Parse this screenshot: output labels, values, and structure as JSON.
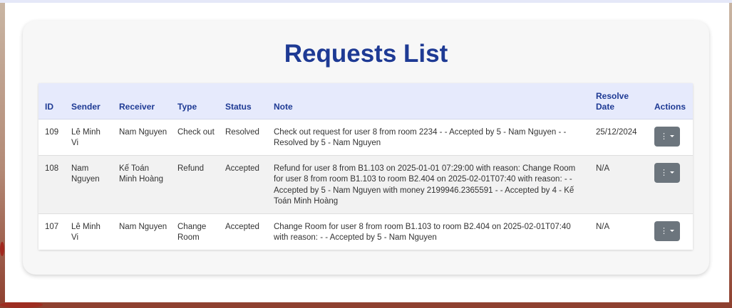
{
  "page": {
    "title": "Requests List"
  },
  "table": {
    "headers": {
      "id": "ID",
      "sender": "Sender",
      "receiver": "Receiver",
      "type": "Type",
      "status": "Status",
      "note": "Note",
      "resolve_date_line1": "Resolve",
      "resolve_date_line2": "Date",
      "actions": "Actions"
    },
    "rows": [
      {
        "id": "109",
        "sender": "Lê Minh Vi",
        "receiver": "Nam Nguyen",
        "type": "Check out",
        "status": "Resolved",
        "note": "Check out request for user 8 from room 2234 - - Accepted by 5 - Nam Nguyen - - Resolved by 5 - Nam Nguyen",
        "resolve_date": "25/12/2024",
        "actions_icon": "more-dropdown-icon"
      },
      {
        "id": "108",
        "sender": "Nam Nguyen",
        "receiver": "Kế Toán Minh Hoàng",
        "type": "Refund",
        "status": "Accepted",
        "note": "Refund for user 8 from B1.103 on 2025-01-01 07:29:00 with reason: Change Room for user 8 from room B1.103 to room B2.404 on 2025-02-01T07:40 with reason: - - Accepted by 5 - Nam Nguyen with money 2199946.2365591 - - Accepted by 4 - Kế Toán Minh Hoàng",
        "resolve_date": "N/A",
        "actions_icon": "more-dropdown-icon"
      },
      {
        "id": "107",
        "sender": "Lê Minh Vi",
        "receiver": "Nam Nguyen",
        "type": "Change Room",
        "status": "Accepted",
        "note": "Change Room for user 8 from room B1.103 to room B2.404 on 2025-02-01T07:40 with reason: - - Accepted by 5 - Nam Nguyen",
        "resolve_date": "N/A",
        "actions_icon": "more-dropdown-icon"
      }
    ]
  },
  "colors": {
    "title": "#1e3a94",
    "header_bg": "#e6eafc",
    "action_button": "#6c757d"
  }
}
